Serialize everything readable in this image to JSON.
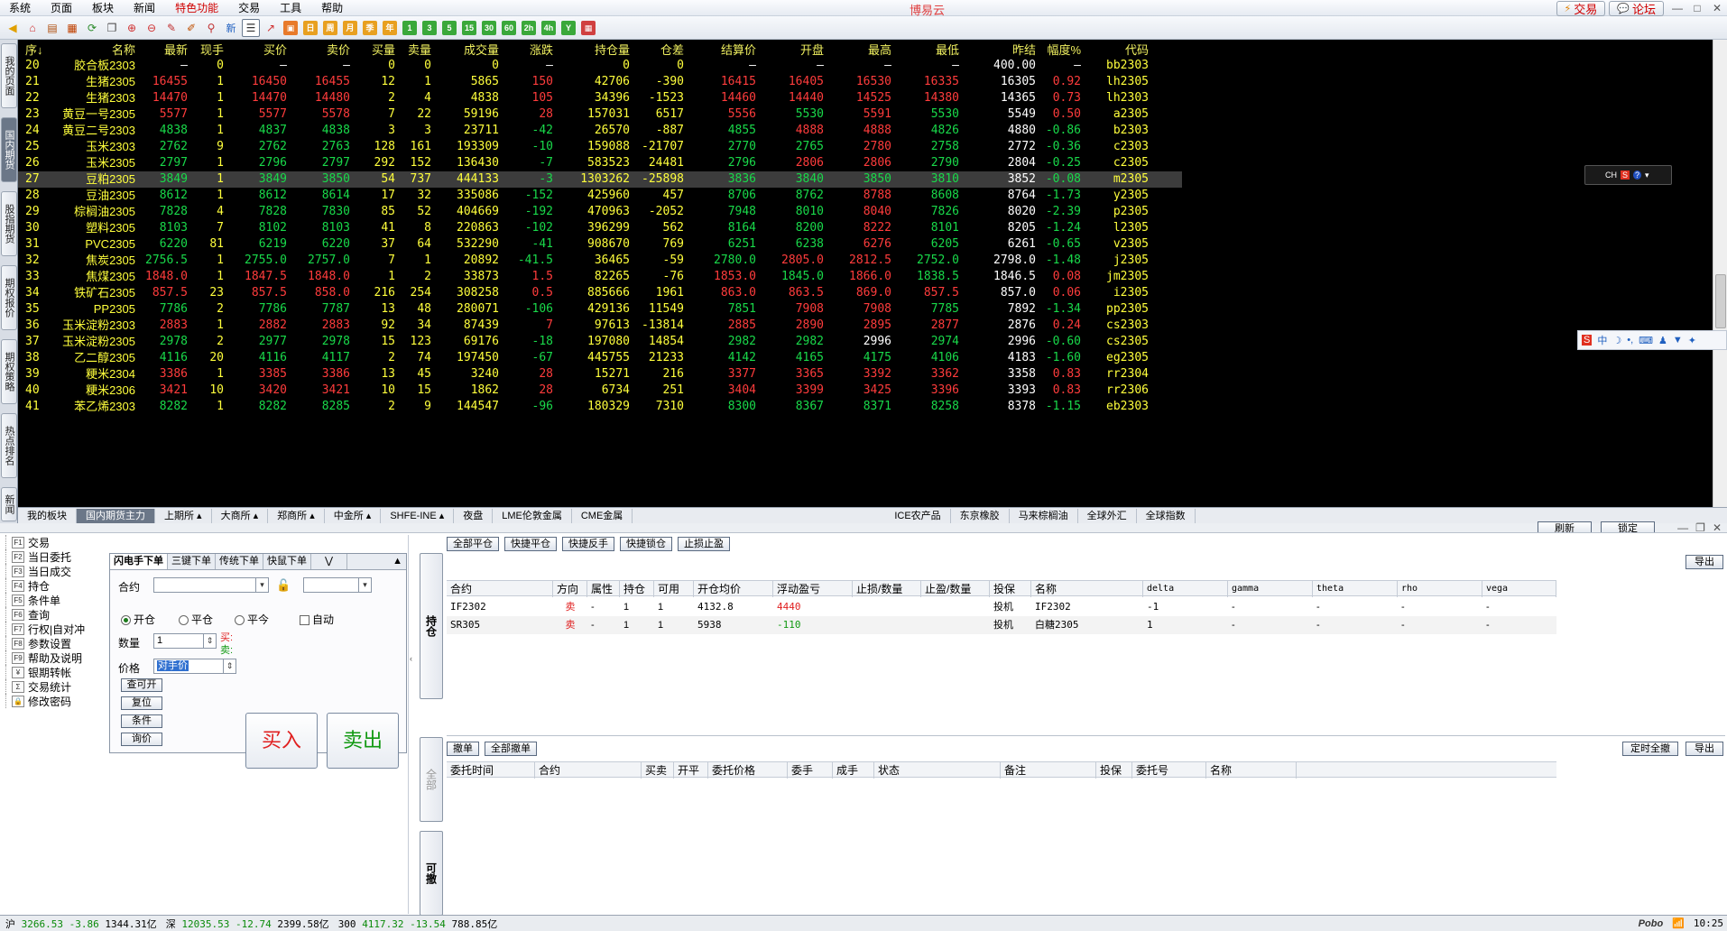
{
  "app": {
    "title": "博易云"
  },
  "menu": [
    "系统",
    "页面",
    "板块",
    "新闻",
    "特色功能",
    "交易",
    "工具",
    "帮助"
  ],
  "top_right": {
    "trade": "交易",
    "forum": "论坛"
  },
  "toolbar_periods": [
    "日",
    "周",
    "月",
    "季",
    "年",
    "1",
    "3",
    "5",
    "15",
    "30",
    "60",
    "2h",
    "4h",
    "Y"
  ],
  "toolbar_new": "新",
  "vtabs": [
    "我的页面",
    "国内期货",
    "股指期货",
    "期权报价",
    "期权策略",
    "热点排名",
    "新闻"
  ],
  "grid": {
    "headers": [
      "序↓",
      "名称",
      "最新",
      "现手",
      "买价",
      "卖价",
      "买量",
      "卖量",
      "成交量",
      "涨跌",
      "持仓量",
      "仓差",
      "结算价",
      "开盘",
      "最高",
      "最低",
      "昨结",
      "幅度%",
      "代码"
    ],
    "rows": [
      [
        "20",
        "胶合板2303",
        "—",
        "0",
        "—",
        "—",
        "0",
        "0",
        "0",
        "—",
        "0",
        "0",
        "—",
        "—",
        "—",
        "—",
        "400.00",
        "—",
        "bb2303"
      ],
      [
        "21",
        "生猪2305",
        "16455",
        "1",
        "16450",
        "16455",
        "12",
        "1",
        "5865",
        "150",
        "42706",
        "-390",
        "16415",
        "16405",
        "16530",
        "16335",
        "16305",
        "0.92",
        "lh2305"
      ],
      [
        "22",
        "生猪2303",
        "14470",
        "1",
        "14470",
        "14480",
        "2",
        "4",
        "4838",
        "105",
        "34396",
        "-1523",
        "14460",
        "14440",
        "14525",
        "14380",
        "14365",
        "0.73",
        "lh2303"
      ],
      [
        "23",
        "黄豆一号2305",
        "5577",
        "1",
        "5577",
        "5578",
        "7",
        "22",
        "59196",
        "28",
        "157031",
        "6517",
        "5556",
        "5530",
        "5591",
        "5530",
        "5549",
        "0.50",
        "a2305"
      ],
      [
        "24",
        "黄豆二号2303",
        "4838",
        "1",
        "4837",
        "4838",
        "3",
        "3",
        "23711",
        "-42",
        "26570",
        "-887",
        "4855",
        "4888",
        "4888",
        "4826",
        "4880",
        "-0.86",
        "b2303"
      ],
      [
        "25",
        "玉米2303",
        "2762",
        "9",
        "2762",
        "2763",
        "128",
        "161",
        "193309",
        "-10",
        "159088",
        "-21707",
        "2770",
        "2765",
        "2780",
        "2758",
        "2772",
        "-0.36",
        "c2303"
      ],
      [
        "26",
        "玉米2305",
        "2797",
        "1",
        "2796",
        "2797",
        "292",
        "152",
        "136430",
        "-7",
        "583523",
        "24481",
        "2796",
        "2806",
        "2806",
        "2790",
        "2804",
        "-0.25",
        "c2305"
      ],
      [
        "27",
        "豆粕2305",
        "3849",
        "1",
        "3849",
        "3850",
        "54",
        "737",
        "444133",
        "-3",
        "1303262",
        "-25898",
        "3836",
        "3840",
        "3850",
        "3810",
        "3852",
        "-0.08",
        "m2305"
      ],
      [
        "28",
        "豆油2305",
        "8612",
        "1",
        "8612",
        "8614",
        "17",
        "32",
        "335086",
        "-152",
        "425960",
        "457",
        "8706",
        "8762",
        "8788",
        "8608",
        "8764",
        "-1.73",
        "y2305"
      ],
      [
        "29",
        "棕榈油2305",
        "7828",
        "4",
        "7828",
        "7830",
        "85",
        "52",
        "404669",
        "-192",
        "470963",
        "-2052",
        "7948",
        "8010",
        "8040",
        "7826",
        "8020",
        "-2.39",
        "p2305"
      ],
      [
        "30",
        "塑料2305",
        "8103",
        "7",
        "8102",
        "8103",
        "41",
        "8",
        "220863",
        "-102",
        "396299",
        "562",
        "8164",
        "8200",
        "8222",
        "8101",
        "8205",
        "-1.24",
        "l2305"
      ],
      [
        "31",
        "PVC2305",
        "6220",
        "81",
        "6219",
        "6220",
        "37",
        "64",
        "532290",
        "-41",
        "908670",
        "769",
        "6251",
        "6238",
        "6276",
        "6205",
        "6261",
        "-0.65",
        "v2305"
      ],
      [
        "32",
        "焦炭2305",
        "2756.5",
        "1",
        "2755.0",
        "2757.0",
        "7",
        "1",
        "20892",
        "-41.5",
        "36465",
        "-59",
        "2780.0",
        "2805.0",
        "2812.5",
        "2752.0",
        "2798.0",
        "-1.48",
        "j2305"
      ],
      [
        "33",
        "焦煤2305",
        "1848.0",
        "1",
        "1847.5",
        "1848.0",
        "1",
        "2",
        "33873",
        "1.5",
        "82265",
        "-76",
        "1853.0",
        "1845.0",
        "1866.0",
        "1838.5",
        "1846.5",
        "0.08",
        "jm2305"
      ],
      [
        "34",
        "铁矿石2305",
        "857.5",
        "23",
        "857.5",
        "858.0",
        "216",
        "254",
        "308258",
        "0.5",
        "885666",
        "1961",
        "863.0",
        "863.5",
        "869.0",
        "857.5",
        "857.0",
        "0.06",
        "i2305"
      ],
      [
        "35",
        "PP2305",
        "7786",
        "2",
        "7786",
        "7787",
        "13",
        "48",
        "280071",
        "-106",
        "429136",
        "11549",
        "7851",
        "7908",
        "7908",
        "7785",
        "7892",
        "-1.34",
        "pp2305"
      ],
      [
        "36",
        "玉米淀粉2303",
        "2883",
        "1",
        "2882",
        "2883",
        "92",
        "34",
        "87439",
        "7",
        "97613",
        "-13814",
        "2885",
        "2890",
        "2895",
        "2877",
        "2876",
        "0.24",
        "cs2303"
      ],
      [
        "37",
        "玉米淀粉2305",
        "2978",
        "2",
        "2977",
        "2978",
        "15",
        "123",
        "69176",
        "-18",
        "197080",
        "14854",
        "2982",
        "2982",
        "2996",
        "2974",
        "2996",
        "-0.60",
        "cs2305"
      ],
      [
        "38",
        "乙二醇2305",
        "4116",
        "20",
        "4116",
        "4117",
        "2",
        "74",
        "197450",
        "-67",
        "445755",
        "21233",
        "4142",
        "4165",
        "4175",
        "4106",
        "4183",
        "-1.60",
        "eg2305"
      ],
      [
        "39",
        "粳米2304",
        "3386",
        "1",
        "3385",
        "3386",
        "13",
        "45",
        "3240",
        "28",
        "15271",
        "216",
        "3377",
        "3365",
        "3392",
        "3362",
        "3358",
        "0.83",
        "rr2304"
      ],
      [
        "40",
        "粳米2306",
        "3421",
        "10",
        "3420",
        "3421",
        "10",
        "15",
        "1862",
        "28",
        "6734",
        "251",
        "3404",
        "3399",
        "3425",
        "3396",
        "3393",
        "0.83",
        "rr2306"
      ],
      [
        "41",
        "苯乙烯2303",
        "8282",
        "1",
        "8282",
        "8285",
        "2",
        "9",
        "144547",
        "-96",
        "180329",
        "7310",
        "8300",
        "8367",
        "8371",
        "8258",
        "8378",
        "-1.15",
        "eb2303"
      ]
    ]
  },
  "grid_tabs": [
    "我的板块",
    "国内期货主力",
    "上期所",
    "大商所",
    "郑商所",
    "中金所",
    "SHFE-INE",
    "夜盘",
    "LME伦敦金属",
    "CME金属",
    "ICE农产品",
    "东京橡胶",
    "马来棕榈油",
    "全球外汇",
    "全球指数"
  ],
  "window_bar": {
    "refresh": "刷新",
    "lock": "锁定"
  },
  "functions": [
    [
      "F1",
      "交易"
    ],
    [
      "F2",
      "当日委托"
    ],
    [
      "F3",
      "当日成交"
    ],
    [
      "F4",
      "持仓"
    ],
    [
      "F5",
      "条件单"
    ],
    [
      "F6",
      "查询"
    ],
    [
      "F7",
      "行权|自对冲"
    ],
    [
      "F8",
      "参数设置"
    ],
    [
      "F9",
      "帮助及说明"
    ],
    [
      "¥",
      "银期转帐"
    ],
    [
      "Σ",
      "交易统计"
    ],
    [
      "🔒",
      "修改密码"
    ]
  ],
  "order_tabs": [
    "闪电手下单",
    "三键下单",
    "传统下单",
    "快鼠下单"
  ],
  "order": {
    "contract_label": "合约",
    "open": "开仓",
    "close": "平仓",
    "close_today": "平今",
    "auto": "自动",
    "qty_label": "数量",
    "qty": "1",
    "buy_hint": "买:",
    "sell_hint": "卖:",
    "price_label": "价格",
    "price": "对手价",
    "btn_query": "查可开",
    "btn_reset": "复位",
    "btn_cond": "条件",
    "btn_inquire": "询价",
    "buy": "买入",
    "sell": "卖出"
  },
  "side_buttons": {
    "positions": "持仓",
    "all": "全部",
    "cancelable": "可撤"
  },
  "positions": {
    "buttons": [
      "全部平仓",
      "快捷平仓",
      "快捷反手",
      "快捷锁仓",
      "止损止盈"
    ],
    "export": "导出",
    "headers": [
      "合约",
      "方向",
      "属性",
      "持仓",
      "可用",
      "开仓均价",
      "浮动盈亏",
      "止损/数量",
      "止盈/数量",
      "投保",
      "名称",
      "delta",
      "gamma",
      "theta",
      "rho",
      "vega"
    ],
    "rows": [
      [
        "IF2302",
        "卖",
        "-",
        "1",
        "1",
        "4132.8",
        "4440",
        "",
        "",
        "投机",
        "IF2302",
        "-1",
        "-",
        "-",
        "-",
        "-"
      ],
      [
        "SR305",
        "卖",
        "-",
        "1",
        "1",
        "5938",
        "-110",
        "",
        "",
        "投机",
        "白糖2305",
        "1",
        "-",
        "-",
        "-",
        "-"
      ]
    ]
  },
  "orders": {
    "buttons": [
      "撤单",
      "全部撤单"
    ],
    "right_buttons": [
      "定时全撤",
      "导出"
    ],
    "headers": [
      "委托时间",
      "合约",
      "买卖",
      "开平",
      "委托价格",
      "委手",
      "成手",
      "状态",
      "备注",
      "投保",
      "委托号",
      "名称"
    ]
  },
  "status": {
    "items": [
      {
        "label": "沪",
        "value": "3266.53",
        "chg": "-3.86",
        "amt": "1344.31亿"
      },
      {
        "label": "深",
        "value": "12035.53",
        "chg": "-12.74",
        "amt": "2399.58亿"
      },
      {
        "label": "300",
        "value": "4117.32",
        "chg": "-13.54",
        "amt": "788.85亿"
      }
    ],
    "brand": "Pobo",
    "time": "10:25"
  }
}
